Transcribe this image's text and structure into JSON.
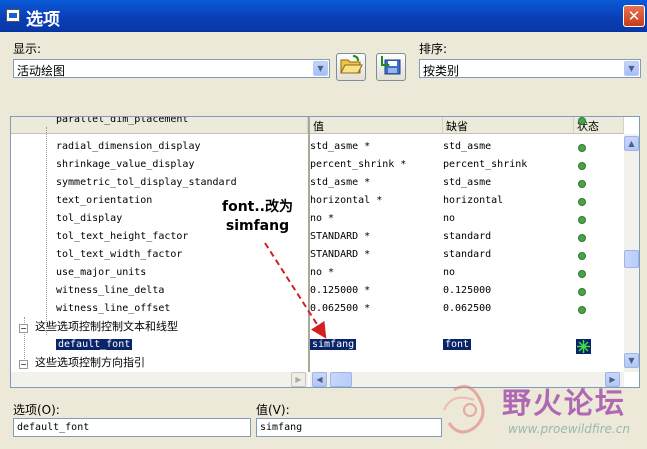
{
  "window": {
    "title": "选项",
    "close": "✕"
  },
  "display": {
    "label": "显示:",
    "value": "活动绘图"
  },
  "sort": {
    "label": "排序:",
    "value": "按类别"
  },
  "icons": {
    "open": "folder-open-icon",
    "save": "save-icon"
  },
  "columns": {
    "value": "值",
    "default": "缺省",
    "status": "状态"
  },
  "rows": [
    {
      "name": "parallel_dim_placement",
      "value": "",
      "default": "",
      "status": "green"
    },
    {
      "name": "radial_dimension_display",
      "value": "std_asme *",
      "default": "std_asme",
      "status": "green"
    },
    {
      "name": "shrinkage_value_display",
      "value": "percent_shrink *",
      "default": "percent_shrink",
      "status": "green"
    },
    {
      "name": "symmetric_tol_display_standard",
      "value": "std_asme *",
      "default": "std_asme",
      "status": "green"
    },
    {
      "name": "text_orientation",
      "value": "horizontal *",
      "default": "horizontal",
      "status": "green"
    },
    {
      "name": "tol_display",
      "value": "no *",
      "default": "no",
      "status": "green"
    },
    {
      "name": "tol_text_height_factor",
      "value": "STANDARD *",
      "default": "standard",
      "status": "green"
    },
    {
      "name": "tol_text_width_factor",
      "value": "STANDARD *",
      "default": "standard",
      "status": "green"
    },
    {
      "name": "use_major_units",
      "value": "no *",
      "default": "no",
      "status": "green"
    },
    {
      "name": "witness_line_delta",
      "value": "0.125000 *",
      "default": "0.125000",
      "status": "green"
    },
    {
      "name": "witness_line_offset",
      "value": "0.062500 *",
      "default": "0.062500",
      "status": "green"
    }
  ],
  "group1": "这些选项控制控制文本和线型",
  "selected_row": {
    "name": "default_font",
    "value": "simfang",
    "default": "font",
    "status": "changed"
  },
  "group2": "这些选项控制方向指引",
  "annotation": {
    "line1": "font..改为",
    "line2": "simfang"
  },
  "option_field": {
    "label": "选项(O):",
    "value": "default_font"
  },
  "value_field": {
    "label": "值(V):",
    "value": "simfang"
  },
  "watermark": {
    "name": "野火论坛",
    "url": "www.proewildfire.cn"
  }
}
